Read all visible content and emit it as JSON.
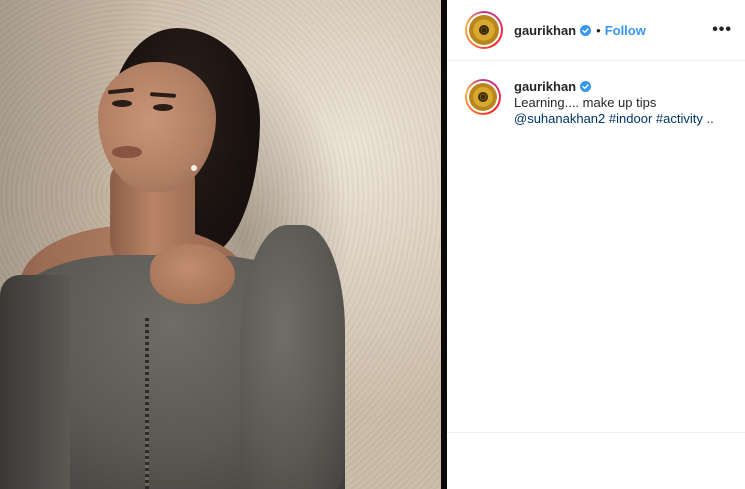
{
  "colors": {
    "link_blue": "#3897f0",
    "hashtag_blue": "#003569",
    "divider": "#0a0a0a",
    "verified_blue": "#3897f0"
  },
  "photo": {
    "icon": "post-photo"
  },
  "header": {
    "username": "gaurikhan",
    "separator": "•",
    "follow_label": "Follow",
    "more_label": "•••"
  },
  "caption": {
    "username": "gaurikhan",
    "text": "Learning.... make up tips",
    "mention": "@suhanakhan2",
    "hashtags": [
      "#indoor",
      "#activity",
      ".."
    ]
  }
}
